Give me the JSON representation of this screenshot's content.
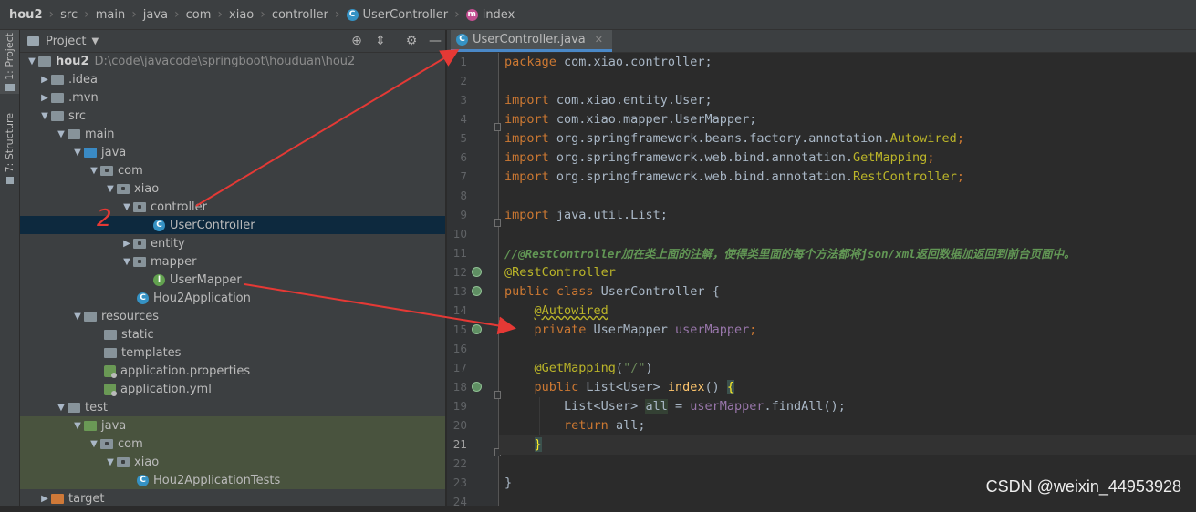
{
  "breadcrumb": {
    "items": [
      "hou2",
      "src",
      "main",
      "java",
      "com",
      "xiao",
      "controller",
      "UserController",
      "index"
    ]
  },
  "toolstrip": {
    "project_tab": "1: Project",
    "structure_tab": "7: Structure"
  },
  "project_panel": {
    "title": "Project",
    "tree": [
      {
        "label": "hou2",
        "hint": "D:\\code\\javacode\\springboot\\houduan\\hou2"
      },
      {
        "label": ".idea"
      },
      {
        "label": ".mvn"
      },
      {
        "label": "src"
      },
      {
        "label": "main"
      },
      {
        "label": "java"
      },
      {
        "label": "com"
      },
      {
        "label": "xiao"
      },
      {
        "label": "controller"
      },
      {
        "label": "UserController"
      },
      {
        "label": "entity"
      },
      {
        "label": "mapper"
      },
      {
        "label": "UserMapper"
      },
      {
        "label": "Hou2Application"
      },
      {
        "label": "resources"
      },
      {
        "label": "static"
      },
      {
        "label": "templates"
      },
      {
        "label": "application.properties"
      },
      {
        "label": "application.yml"
      },
      {
        "label": "test"
      },
      {
        "label": "java"
      },
      {
        "label": "com"
      },
      {
        "label": "xiao"
      },
      {
        "label": "Hou2ApplicationTests"
      },
      {
        "label": "target"
      }
    ]
  },
  "editor": {
    "tab_label": "UserController.java",
    "current_line": "21",
    "code": {
      "l1_kw": "package",
      "l1_rest": " com.xiao.controller;",
      "l3_kw": "import",
      "l3_rest": " com.xiao.entity.User;",
      "l4_kw": "import",
      "l4_rest": " com.xiao.mapper.UserMapper;",
      "l5_kw": "import",
      "l5_rest": " org.springframework.beans.factory.annotation.",
      "l5_ann": "Autowired",
      "l5_end": ";",
      "l6_kw": "import",
      "l6_rest": " org.springframework.web.bind.annotation.",
      "l6_ann": "GetMapping",
      "l6_end": ";",
      "l7_kw": "import",
      "l7_rest": " org.springframework.web.bind.annotation.",
      "l7_ann": "RestController",
      "l7_end": ";",
      "l9_kw": "import",
      "l9_rest": " java.util.List;",
      "l11_comment": "//@RestController加在类上面的注解，使得类里面的每个方法都将json/xml返回数据加返回到前台页面中。",
      "l12_ann": "@RestController",
      "l13_kw": "public class",
      "l13_rest": " UserController {",
      "l14_ann": "@Autowired",
      "l15_kw": "private",
      "l15_type": " UserMapper ",
      "l15_fld": "userMapper",
      "l15_end": ";",
      "l17_ann": "@GetMapping",
      "l17_open": "(",
      "l17_str": "\"/\"",
      "l17_close": ")",
      "l18_kw": "public",
      "l18_type": " List<User> ",
      "l18_fn": "index",
      "l18_paren": "() ",
      "l18_brace": "{",
      "l19_type": "List<User> ",
      "l19_var": "all",
      "l19_eq": " = ",
      "l19_fld": "userMapper",
      "l19_call": ".findAll();",
      "l20_kw": "return",
      "l20_rest": " all;",
      "l21_brace": "}",
      "l23_brace": "}"
    }
  },
  "annotation": {
    "handwritten_mark": "2"
  },
  "watermark": "CSDN @weixin_44953928"
}
